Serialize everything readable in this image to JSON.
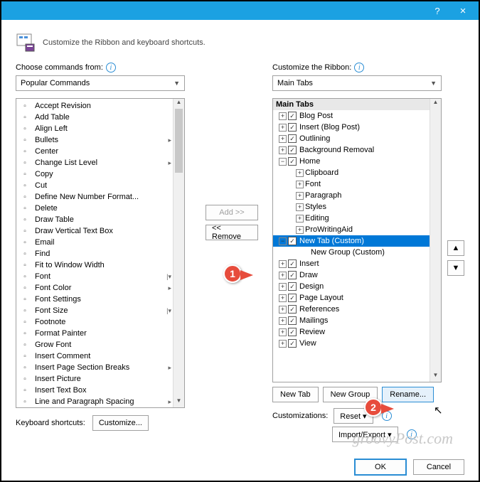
{
  "header": "Customize the Ribbon and keyboard shortcuts.",
  "left": {
    "label": "Choose commands from:",
    "combo": "Popular Commands",
    "items": [
      {
        "t": "Accept Revision"
      },
      {
        "t": "Add Table"
      },
      {
        "t": "Align Left"
      },
      {
        "t": "Bullets",
        "sub": "▸"
      },
      {
        "t": "Center"
      },
      {
        "t": "Change List Level",
        "sub": "▸"
      },
      {
        "t": "Copy"
      },
      {
        "t": "Cut"
      },
      {
        "t": "Define New Number Format..."
      },
      {
        "t": "Delete"
      },
      {
        "t": "Draw Table"
      },
      {
        "t": "Draw Vertical Text Box"
      },
      {
        "t": "Email"
      },
      {
        "t": "Find"
      },
      {
        "t": "Fit to Window Width"
      },
      {
        "t": "Font",
        "sub": "|▾"
      },
      {
        "t": "Font Color",
        "sub": "▸"
      },
      {
        "t": "Font Settings"
      },
      {
        "t": "Font Size",
        "sub": "|▾"
      },
      {
        "t": "Footnote"
      },
      {
        "t": "Format Painter"
      },
      {
        "t": "Grow Font"
      },
      {
        "t": "Insert Comment"
      },
      {
        "t": "Insert Page Section Breaks",
        "sub": "▸"
      },
      {
        "t": "Insert Picture"
      },
      {
        "t": "Insert Text Box"
      },
      {
        "t": "Line and Paragraph Spacing",
        "sub": "▸"
      }
    ]
  },
  "mid": {
    "add": "Add >>",
    "remove": "<< Remove"
  },
  "right": {
    "label": "Customize the Ribbon:",
    "combo": "Main Tabs",
    "header": "Main Tabs",
    "nodes": [
      {
        "d": 1,
        "e": "+",
        "c": true,
        "t": "Blog Post"
      },
      {
        "d": 1,
        "e": "+",
        "c": true,
        "t": "Insert (Blog Post)"
      },
      {
        "d": 1,
        "e": "+",
        "c": true,
        "t": "Outlining"
      },
      {
        "d": 1,
        "e": "+",
        "c": true,
        "t": "Background Removal"
      },
      {
        "d": 1,
        "e": "−",
        "c": true,
        "t": "Home"
      },
      {
        "d": 2,
        "e": "+",
        "t": "Clipboard"
      },
      {
        "d": 2,
        "e": "+",
        "t": "Font"
      },
      {
        "d": 2,
        "e": "+",
        "t": "Paragraph"
      },
      {
        "d": 2,
        "e": "+",
        "t": "Styles"
      },
      {
        "d": 2,
        "e": "+",
        "t": "Editing"
      },
      {
        "d": 2,
        "e": "+",
        "t": "ProWritingAid"
      },
      {
        "d": 1,
        "e": "−",
        "c": true,
        "t": "New Tab (Custom)",
        "sel": true
      },
      {
        "d": 3,
        "t": "New Group (Custom)"
      },
      {
        "d": 1,
        "e": "+",
        "c": true,
        "t": "Insert"
      },
      {
        "d": 1,
        "e": "+",
        "c": true,
        "t": "Draw"
      },
      {
        "d": 1,
        "e": "+",
        "c": true,
        "t": "Design"
      },
      {
        "d": 1,
        "e": "+",
        "c": true,
        "t": "Page Layout"
      },
      {
        "d": 1,
        "e": "+",
        "c": true,
        "t": "References"
      },
      {
        "d": 1,
        "e": "+",
        "c": true,
        "t": "Mailings"
      },
      {
        "d": 1,
        "e": "+",
        "c": true,
        "t": "Review"
      },
      {
        "d": 1,
        "e": "+",
        "c": true,
        "t": "View"
      }
    ],
    "newTab": "New Tab",
    "newGroup": "New Group",
    "rename": "Rename...",
    "custLbl": "Customizations:",
    "reset": "Reset ▾",
    "impexp": "Import/Export ▾"
  },
  "kbs": {
    "label": "Keyboard shortcuts:",
    "btn": "Customize..."
  },
  "footer": {
    "ok": "OK",
    "cancel": "Cancel"
  },
  "watermark": "groovyPost.com",
  "callouts": {
    "c1": "1",
    "c2": "2"
  }
}
